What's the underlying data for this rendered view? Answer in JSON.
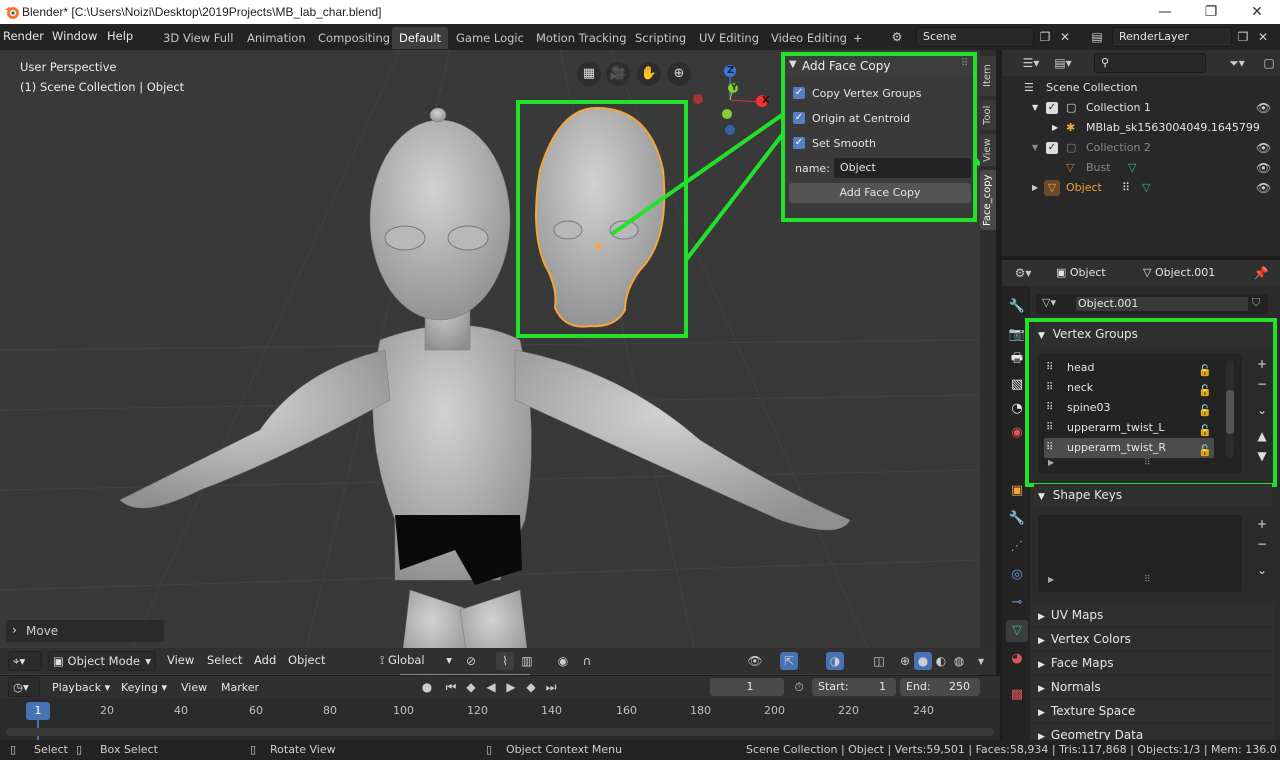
{
  "titlebar": {
    "title": "Blender* [C:\\Users\\Noizi\\Desktop\\2019Projects\\MB_lab_char.blend]",
    "min": "—",
    "max": "❐",
    "close": "✕"
  },
  "menu": {
    "items": [
      "Render",
      "Window",
      "Help"
    ]
  },
  "workspaces": [
    "3D View Full",
    "Animation",
    "Compositing",
    "Default",
    "Game Logic",
    "Motion Tracking",
    "Scripting",
    "UV Editing",
    "Video Editing"
  ],
  "add_workspace": "+",
  "scene": {
    "name": "Scene",
    "view_layer": "RenderLayer"
  },
  "viewport": {
    "perspective": "User Perspective",
    "collection_info": "(1) Scene Collection | Object",
    "last_op": "Move",
    "gizmo": {
      "x": "X",
      "y": "Y",
      "z": "Z"
    }
  },
  "sidebar_tabs": [
    "Item",
    "Tool",
    "View",
    "Face_copy"
  ],
  "face_copy": {
    "title": "Add Face Copy",
    "options": [
      {
        "label": "Copy Vertex Groups",
        "checked": true
      },
      {
        "label": "Origin at Centroid",
        "checked": true
      },
      {
        "label": "Set Smooth",
        "checked": true
      }
    ],
    "name_label": "name:",
    "name_value": "Object",
    "button": "Add Face Copy"
  },
  "vp_header": {
    "mode": "Object Mode",
    "menus": [
      "View",
      "Select",
      "Add",
      "Object"
    ],
    "orientation": "Global"
  },
  "timeline": {
    "menus": [
      "Playback",
      "Keying",
      "View",
      "Marker"
    ],
    "current_frame": "1",
    "start_label": "Start:",
    "start": "1",
    "end_label": "End:",
    "end": "250",
    "ticks": [
      "1",
      "20",
      "40",
      "60",
      "80",
      "100",
      "120",
      "140",
      "160",
      "180",
      "200",
      "220",
      "240"
    ]
  },
  "status": {
    "select": "Select",
    "box_select": "Box Select",
    "rotate": "Rotate View",
    "context": "Object Context Menu",
    "stats": "Scene Collection | Object | Verts:59,501 | Faces:58,934 | Tris:117,868 | Objects:1/3 | Mem: 136.0 MB (11"
  },
  "outliner": {
    "items": [
      {
        "label": "Scene Collection"
      },
      {
        "label": "Collection 1"
      },
      {
        "label": "MBlab_sk1563004049.1645799"
      },
      {
        "label": "Collection 2"
      },
      {
        "label": "Bust"
      },
      {
        "label": "Object"
      }
    ]
  },
  "properties": {
    "breadcrumb_object": "Object",
    "breadcrumb_data": "Object.001",
    "data_name": "Object.001",
    "sections": {
      "vertex_groups": "Vertex Groups",
      "shape_keys": "Shape Keys",
      "uv_maps": "UV Maps",
      "vertex_colors": "Vertex Colors",
      "face_maps": "Face Maps",
      "normals": "Normals",
      "texture_space": "Texture Space",
      "geometry_data": "Geometry Data"
    },
    "vertex_groups": [
      "head",
      "neck",
      "spine03",
      "upperarm_twist_L",
      "upperarm_twist_R"
    ],
    "selected_group": "upperarm_twist_R"
  },
  "colors": {
    "highlight": "#21e12a",
    "accent": "#5680c2",
    "selection_orange": "#f5a53a"
  }
}
